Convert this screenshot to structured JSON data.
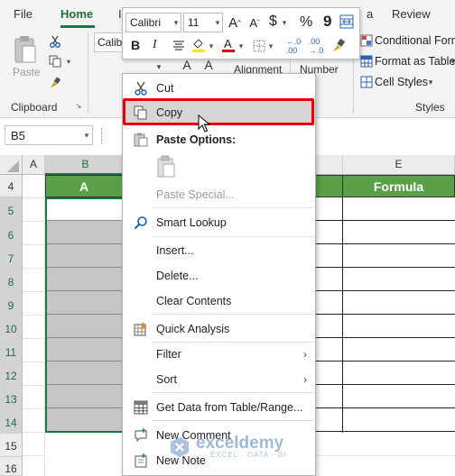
{
  "ribbon": {
    "tabs": [
      {
        "label": "File"
      },
      {
        "label": "Home"
      },
      {
        "label": "I"
      },
      {
        "label": "a"
      },
      {
        "label": "Review"
      }
    ],
    "clipboard": {
      "paste": "Paste",
      "group": "Clipboard"
    },
    "font_box": "Calib",
    "alignment": "Alignment",
    "number": "Number",
    "styles": {
      "conditional": "Conditional Form",
      "format_table": "Format as Table",
      "cell_styles": "Cell Styles",
      "group": "Styles"
    }
  },
  "mini_toolbar": {
    "font": "Calibri",
    "size": "11",
    "bold": "B",
    "italic": "I",
    "currency": "$",
    "percent": "%",
    "comma": "9"
  },
  "namebox": "B5",
  "grid": {
    "columns": [
      "A",
      "B",
      "E"
    ],
    "rows": [
      "4",
      "5",
      "6",
      "7",
      "8",
      "9",
      "10",
      "11",
      "12",
      "13",
      "14",
      "15",
      "16"
    ],
    "header_left": "A",
    "header_right": "Formula"
  },
  "menu": {
    "items": [
      {
        "label": "Cut"
      },
      {
        "label": "Copy"
      },
      {
        "label": "Paste Options:"
      },
      {
        "label": "Paste Special..."
      },
      {
        "label": "Smart Lookup"
      },
      {
        "label": "Insert..."
      },
      {
        "label": "Delete..."
      },
      {
        "label": "Clear Contents"
      },
      {
        "label": "Quick Analysis"
      },
      {
        "label": "Filter"
      },
      {
        "label": "Sort"
      },
      {
        "label": "Get Data from Table/Range..."
      },
      {
        "label": "New Comment"
      },
      {
        "label": "New Note"
      }
    ]
  },
  "watermark": {
    "name": "exceldemy",
    "tagline": "EXCEL · DATA · BI"
  },
  "colors": {
    "accent": "#217346",
    "header_green": "#5aa047",
    "highlight": "#e8000b"
  }
}
